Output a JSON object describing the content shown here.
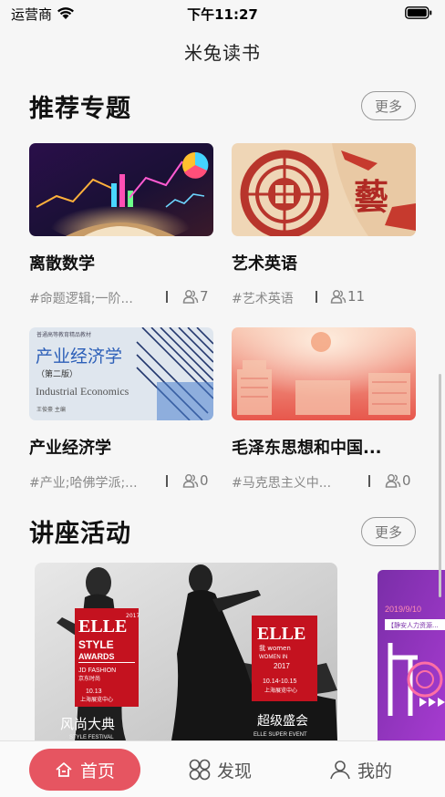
{
  "status_bar": {
    "carrier": "运营商",
    "time": "下午11:27"
  },
  "app_title": "米兔读书",
  "recommended": {
    "title": "推荐专题",
    "more_label": "更多",
    "cards": [
      {
        "title": "离散数学",
        "tags": "#命题逻辑;一阶...",
        "count": "7"
      },
      {
        "title": "艺术英语",
        "tags": "#艺术英语",
        "count": "11"
      },
      {
        "title": "产业经济学",
        "tags": "#产业;哈佛学派;...",
        "count": "0"
      },
      {
        "title": "毛泽东思想和中国...",
        "tags": "#马克思主义中...",
        "count": "0"
      }
    ],
    "cover_text": {
      "art_char": "藝",
      "econ_top": "普通高等教育精品教材",
      "econ_title": "产业经济学",
      "econ_edition": "（第二版）",
      "econ_en": "Industrial Economics",
      "econ_author": "王俊豪 主编"
    }
  },
  "lectures": {
    "title": "讲座活动",
    "more_label": "更多",
    "poster_1": {
      "brand": "ELLE",
      "year": "2017",
      "award_1": "STYLE",
      "award_2": "AWARDS",
      "sponsor": "JD FASHION",
      "sponsor_cn": "京东时尚",
      "date_1": "10.13",
      "venue_1": "上海展览中心",
      "brand_2": "ELLE",
      "sub_2": "我 women",
      "sub_2b": "WOMEN IN",
      "year_2": "2017",
      "date_2": "10.14-10.15",
      "venue_2": "上海展览中心",
      "caption_left": "风尚大典",
      "caption_left_en": "STYLE FESTIVAL",
      "caption_right": "超级盛会",
      "caption_right_en": "ELLE SUPER EVENT"
    },
    "poster_2": {
      "date": "2019/9/10",
      "line": "【静安人力资源..."
    }
  },
  "tab_bar": {
    "home": "首页",
    "discover": "发现",
    "mine": "我的"
  },
  "colors": {
    "accent": "#e65561",
    "text_dark": "#111111",
    "text_muted": "#888888"
  }
}
